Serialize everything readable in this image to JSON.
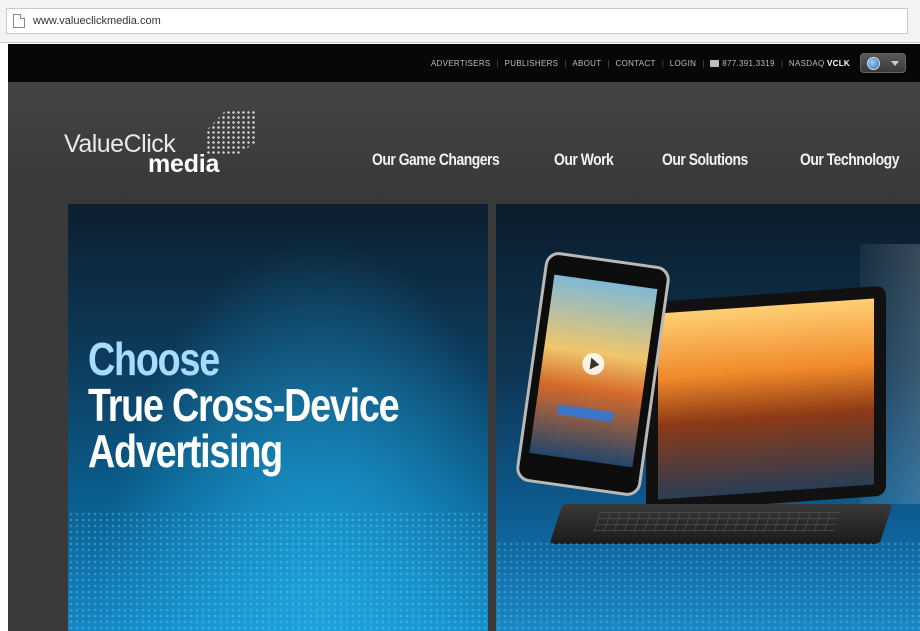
{
  "browser": {
    "url": "www.valueclickmedia.com"
  },
  "topnav": {
    "items": [
      "ADVERTISERS",
      "PUBLISHERS",
      "ABOUT",
      "CONTACT",
      "LOGIN"
    ],
    "phone": "877.391.3319",
    "nasdaq_label": "NASDAQ",
    "nasdaq_ticker": "VCLK",
    "language_icon": "globe-icon"
  },
  "logo": {
    "line1": "ValueClick",
    "line2": "media"
  },
  "mainnav": [
    "Our Game Changers",
    "Our Work",
    "Our Solutions",
    "Our Technology"
  ],
  "hero": {
    "line1": "Choose",
    "line2": "True Cross-Device",
    "line3": "Advertising"
  },
  "colors": {
    "topbar": "#070707",
    "header": "#3a3a3a",
    "headline_accent": "#a8dcff",
    "hero_blue": "#0a5f8f"
  }
}
